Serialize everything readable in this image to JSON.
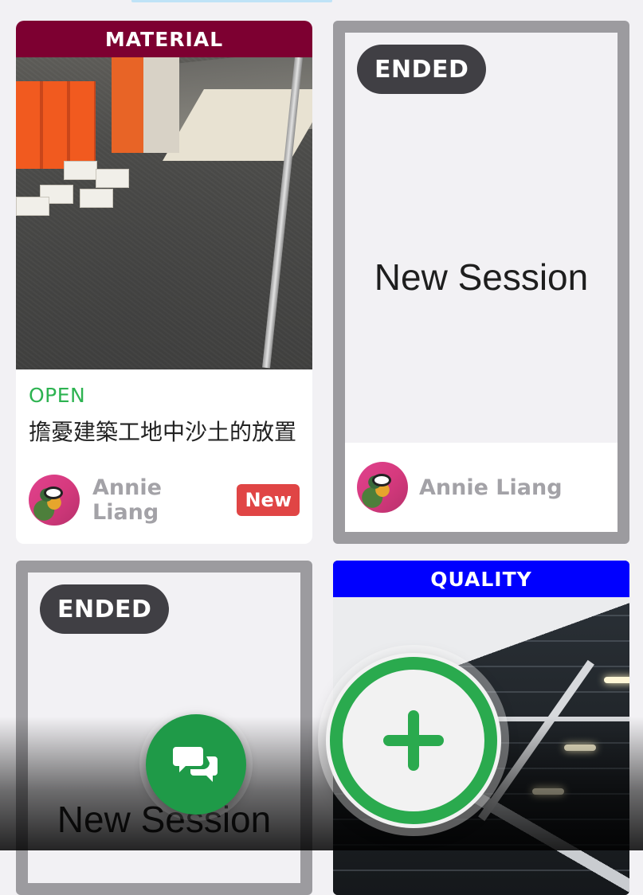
{
  "cards": [
    {
      "category": "MATERIAL",
      "category_color": "#7d0031",
      "status": "OPEN",
      "title": "擔憂建築工地中沙土的放置",
      "author": "Annie Liang",
      "badge": "New"
    },
    {
      "status": "ENDED",
      "title": "New Session",
      "author": "Annie Liang"
    },
    {
      "status": "ENDED",
      "title": "New Session"
    },
    {
      "category": "QUALITY",
      "category_color": "#0000ff"
    }
  ],
  "fabs": {
    "chat_icon": "chat-bubbles-icon",
    "add_icon": "plus-icon"
  },
  "colors": {
    "open_status": "#2db351",
    "ended_pill": "#403f44",
    "new_badge": "#e04545",
    "fab_green": "#2aaa4e"
  }
}
